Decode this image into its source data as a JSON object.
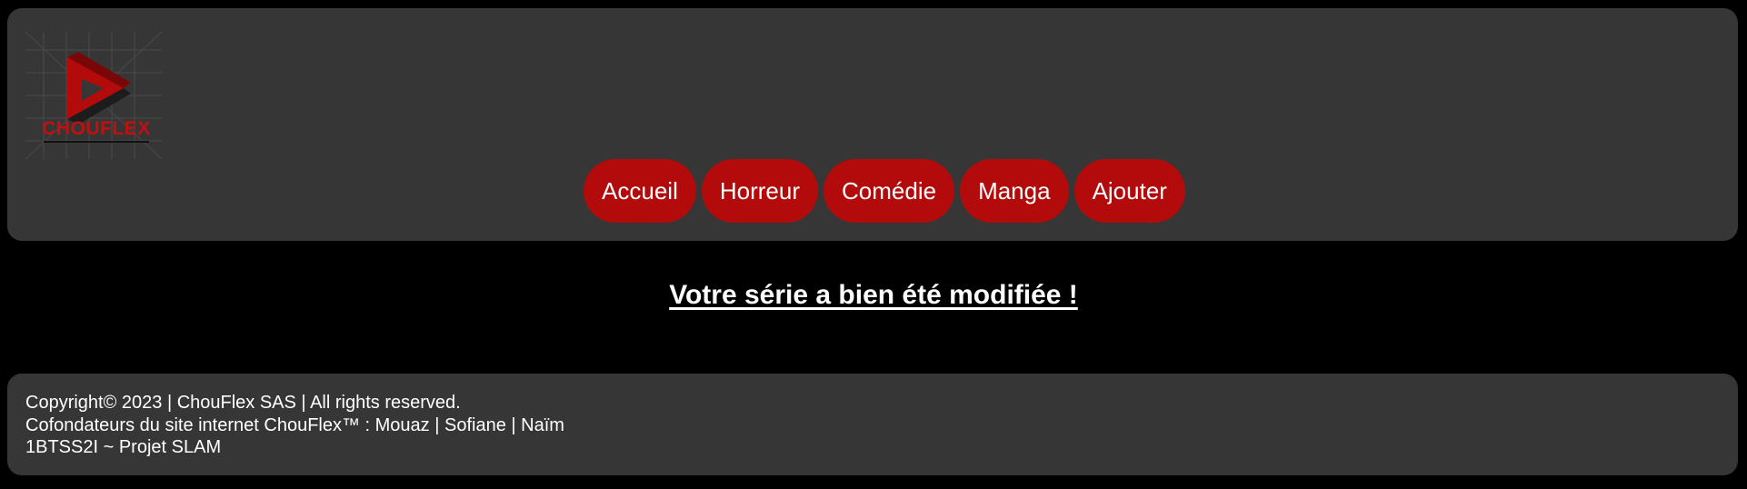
{
  "brand": {
    "logo_text": "CHOUFLEX",
    "accent_color": "#b30b0b"
  },
  "nav": {
    "items": [
      {
        "label": "Accueil"
      },
      {
        "label": "Horreur"
      },
      {
        "label": "Comédie"
      },
      {
        "label": "Manga"
      },
      {
        "label": "Ajouter"
      }
    ]
  },
  "main": {
    "message": "Votre série a bien été modifiée !"
  },
  "footer": {
    "copyright": "Copyright© 2023 | ChouFlex SAS | All rights reserved.",
    "founders": "Cofondateurs du site internet ChouFlex™ : Mouaz | Sofiane | Naïm",
    "project": "1BTSS2I ~ Projet SLAM"
  }
}
